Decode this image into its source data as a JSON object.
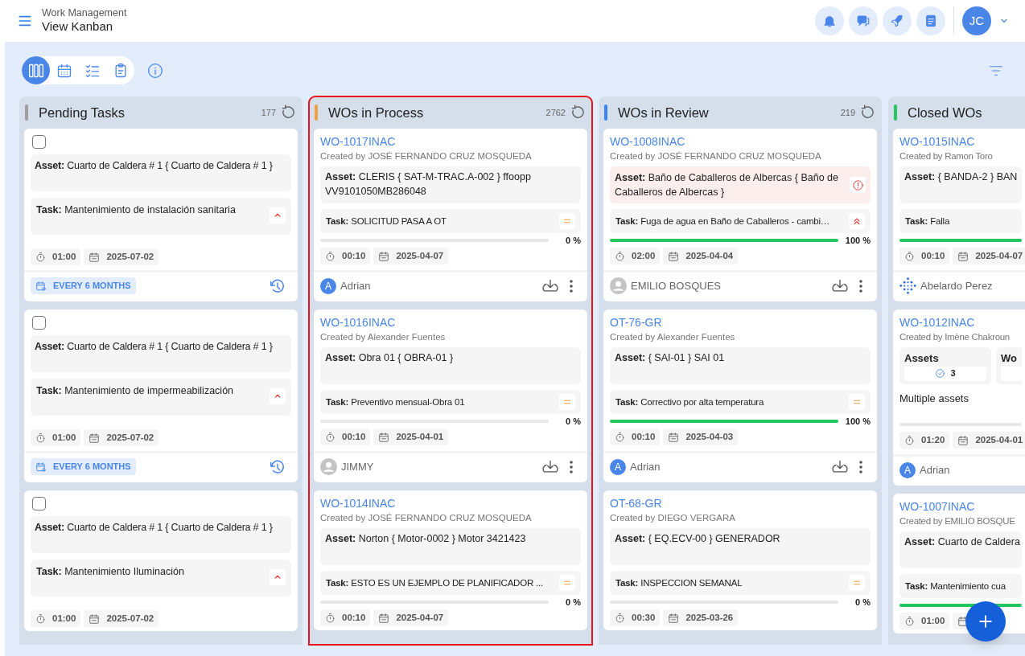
{
  "header": {
    "section": "Work Management",
    "title": "View Kanban",
    "actions": [
      {
        "kind": "bell"
      },
      {
        "kind": "chat"
      },
      {
        "kind": "rocket"
      },
      {
        "kind": "document"
      }
    ],
    "user_initials": "JC"
  },
  "views": [
    {
      "kind": "kanban",
      "selected": true
    },
    {
      "kind": "calendar",
      "selected": false
    },
    {
      "kind": "checklist",
      "selected": false
    },
    {
      "kind": "clipboard",
      "selected": false
    }
  ],
  "columns": [
    {
      "title": "Pending Tasks",
      "count": "177",
      "color": "#9e9e9e",
      "highlighted": false,
      "cards": [
        {
          "kind": "scheduled",
          "checked": false,
          "asset": "**Asset:** Cuarto de Caldera # 1 { Cuarto de Caldera # 1 }",
          "task": "**Task:** Mantenimiento de instalación sanitaria",
          "priority": {
            "kind": "high"
          },
          "time": "01:00",
          "date": "2025-07-02",
          "recurrence": "EVERY 6 MONTHS"
        },
        {
          "kind": "scheduled",
          "checked": false,
          "asset": "**Asset:** Cuarto de Caldera # 1 { Cuarto de Caldera # 1 }",
          "task": "**Task:** Mantenimiento de impermeabilización",
          "priority": {
            "kind": "high"
          },
          "time": "01:00",
          "date": "2025-07-02",
          "recurrence": "EVERY 6 MONTHS"
        },
        {
          "kind": "scheduled",
          "checked": false,
          "asset": "**Asset:** Cuarto de Caldera # 1 { Cuarto de Caldera # 1 }",
          "task": "**Task:** Mantenimiento Iluminación",
          "priority": {
            "kind": "high"
          },
          "time": "01:00",
          "date": "2025-07-02"
        }
      ]
    },
    {
      "title": "WOs in Process",
      "count": "2762",
      "color": "#f0a040",
      "highlighted": true,
      "cards": [
        {
          "kind": "work_order",
          "id": "WO-1017INAC",
          "creator": "Created by JOSÉ FERNANDO CRUZ MOSQUEDA",
          "asset": "**Asset:** CLERIS { SAT-M-TRAC.A-002 } ffoopp VV9101050MB286048",
          "alert": false,
          "task": "**Task:** SOLICITUD PASA A OT",
          "priority": {
            "kind": "medium"
          },
          "level": 0,
          "percent": "0 %",
          "time": "00:10",
          "date": "2025-04-07",
          "assignee": {
            "name": "Adrian",
            "kind": "letter",
            "initial": "A"
          },
          "actions": true
        },
        {
          "kind": "work_order",
          "id": "WO-1016INAC",
          "creator": "Created by Alexander Fuentes",
          "asset": "**Asset:** Obra 01 { OBRA-01 }",
          "alert": false,
          "task": "**Task:** Preventivo mensual-Obra 01",
          "priority": {
            "kind": "medium"
          },
          "level": 0,
          "percent": "0 %",
          "time": "00:10",
          "date": "2025-04-01",
          "assignee": {
            "name": "JIMMY",
            "kind": "person"
          },
          "actions": true
        },
        {
          "kind": "work_order",
          "id": "WO-1014INAC",
          "creator": "Created by JOSÉ FERNANDO CRUZ MOSQUEDA",
          "asset": "**Asset:** Norton { Motor-0002 } Motor 3421423",
          "alert": false,
          "task": "**Task:** ESTO ES UN EJEMPLO DE PLANIFICADOR ...",
          "priority": {
            "kind": "medium"
          },
          "level": 0,
          "percent": "0 %",
          "time": "00:10",
          "date": "2025-04-07"
        }
      ]
    },
    {
      "title": "WOs in Review",
      "count": "219",
      "color": "#3b82f6",
      "highlighted": false,
      "cards": [
        {
          "kind": "work_order",
          "id": "WO-1008INAC",
          "creator": "Created by JOSÉ FERNANDO CRUZ MOSQUEDA",
          "asset": "**Asset:** Baño de Caballeros de Albercas { Baño de Caballeros de Albercas }",
          "alert": true,
          "task": "**Task:** Fuga de agua en Baño de Caballeros - cambi…",
          "priority": {
            "kind": "urgent"
          },
          "level": 1,
          "percent": "100 %",
          "time": "02:00",
          "date": "2025-04-04",
          "assignee": {
            "name": "EMILIO BOSQUES",
            "kind": "person"
          },
          "actions": true
        },
        {
          "kind": "work_order",
          "id": "OT-76-GR",
          "creator": "Created by Alexander Fuentes",
          "asset": "**Asset:**  { SAI-01 } SAI 01",
          "alert": false,
          "task": "**Task:** Correctivo por alta temperatura",
          "priority": {
            "kind": "medium"
          },
          "level": 1,
          "percent": "100 %",
          "time": "00:10",
          "date": "2025-04-03",
          "assignee": {
            "name": "Adrian",
            "kind": "letter",
            "initial": "A"
          },
          "actions": true
        },
        {
          "kind": "work_order",
          "id": "OT-68-GR",
          "creator": "Created by DIEGO VERGARA",
          "asset": "**Asset:** { EQ.ECV-00 } GENERADOR",
          "alert": false,
          "task": "**Task:** INSPECCION SEMANAL",
          "priority": {
            "kind": "medium"
          },
          "level": 0,
          "percent": "0 %",
          "time": "00:30",
          "date": "2025-03-26"
        }
      ]
    },
    {
      "title": "Closed WOs",
      "color": "#22c55e",
      "highlighted": false,
      "cards": [
        {
          "kind": "work_order",
          "id": "WO-1015INAC",
          "creator": "Created by Ramon Toro",
          "asset": "**Asset:**  { BANDA-2 } BAN",
          "alert": false,
          "task": "**Task:** Falla",
          "level": 1,
          "time": "00:10",
          "date": "2025-04-07",
          "assignee": {
            "name": "Abelardo Perez",
            "kind": "logo"
          }
        },
        {
          "kind": "multi_asset",
          "id": "WO-1012INAC",
          "creator": "Created by Imène Chakroun",
          "stat_label": "Assets",
          "stat_count": "3",
          "second_stat_label": "Wo",
          "summary": "Multiple assets",
          "level": 0,
          "time": "01:20",
          "date": "2025-04-01",
          "assignee": {
            "name": "Adrian",
            "kind": "letter",
            "initial": "A"
          }
        },
        {
          "kind": "work_order",
          "id": "WO-1007INAC",
          "creator": "Created by EMILIO BOSQUE",
          "asset": "**Asset:** Cuarto de Caldera",
          "alert": false,
          "task": "**Task:** Mantenimiento cua",
          "level": 1,
          "time": "01:00"
        }
      ]
    }
  ]
}
